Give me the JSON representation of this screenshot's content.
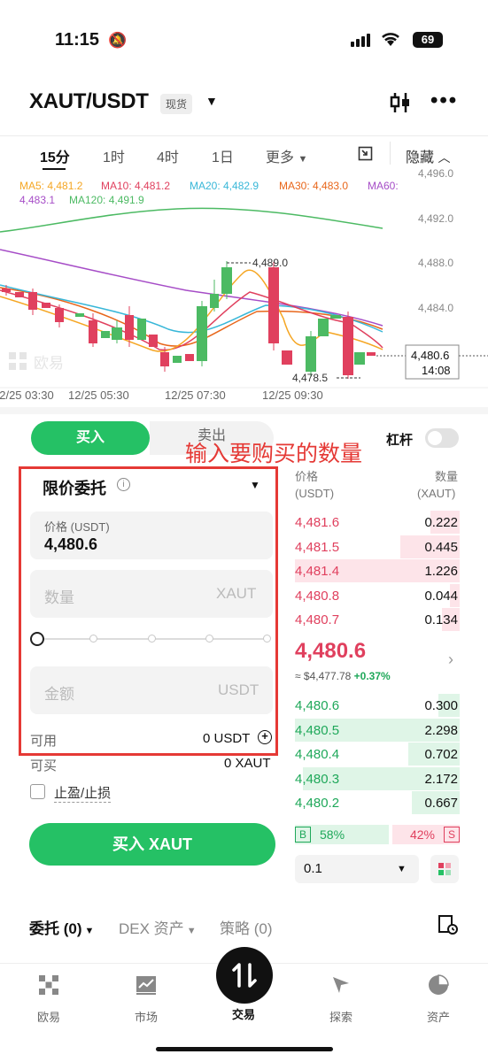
{
  "status": {
    "time": "11:15",
    "battery": "69"
  },
  "header": {
    "pair": "XAUT/USDT",
    "market_badge": "现货"
  },
  "timeframes": [
    "15分",
    "1时",
    "4时",
    "1日",
    "更多"
  ],
  "hide_label": "隐藏",
  "ma_legend": {
    "ma5": "MA5: 4,481.2",
    "ma10": "MA10: 4,481.2",
    "ma20": "MA20: 4,482.9",
    "ma30": "MA30: 4,483.0",
    "ma60_label": "MA60:",
    "ma60_value": "4,483.1",
    "ma120": "MA120: 4,491.9",
    "colors": {
      "ma5": "#f5a623",
      "ma10": "#e0405e",
      "ma20": "#38b7d8",
      "ma30": "#e8661a",
      "ma60": "#a64dc7",
      "ma120": "#4cba63"
    }
  },
  "chart": {
    "y_ticks": [
      "4,496.0",
      "4,492.0",
      "4,488.0",
      "4,484.0"
    ],
    "x_ticks": [
      "12/25 03:30",
      "12/25 05:30",
      "12/25 07:30",
      "12/25 09:30"
    ],
    "high_label": "4,489.0",
    "low_label": "4,478.5",
    "last_price": "4,480.6",
    "countdown": "14:08",
    "watermark": "欧易"
  },
  "trade": {
    "buy_tab": "买入",
    "sell_tab": "卖出",
    "leverage": "杠杆",
    "annotation": "输入要购买的数量",
    "order_type": "限价委托",
    "price_label": "价格 (USDT)",
    "price_value": "4,480.6",
    "qty_placeholder": "数量",
    "qty_unit": "XAUT",
    "amount_placeholder": "金额",
    "amount_unit": "USDT",
    "available_label": "可用",
    "available_value": "0 USDT",
    "can_buy_label": "可买",
    "can_buy_value": "0 XAUT",
    "tpsl_label": "止盈/止损",
    "buy_button": "买入 XAUT"
  },
  "orderbook": {
    "price_header": "价格",
    "price_unit": "(USDT)",
    "qty_header": "数量",
    "qty_unit": "(XAUT)",
    "asks": [
      {
        "price": "4,481.6",
        "qty": "0.222",
        "depth": 0.18
      },
      {
        "price": "4,481.5",
        "qty": "0.445",
        "depth": 0.36
      },
      {
        "price": "4,481.4",
        "qty": "1.226",
        "depth": 1.0
      },
      {
        "price": "4,480.8",
        "qty": "0.044",
        "depth": 0.06
      },
      {
        "price": "4,480.7",
        "qty": "0.134",
        "depth": 0.11
      }
    ],
    "mid_price": "4,480.6",
    "mid_usd": "≈ $4,477.78",
    "mid_change": "+0.37%",
    "bids": [
      {
        "price": "4,480.6",
        "qty": "0.300",
        "depth": 0.13
      },
      {
        "price": "4,480.5",
        "qty": "2.298",
        "depth": 1.0
      },
      {
        "price": "4,480.4",
        "qty": "0.702",
        "depth": 0.31
      },
      {
        "price": "4,480.3",
        "qty": "2.172",
        "depth": 0.95
      },
      {
        "price": "4,480.2",
        "qty": "0.667",
        "depth": 0.29
      }
    ],
    "buy_ratio": "58%",
    "sell_ratio": "42%",
    "buy_ratio_value": 0.58,
    "b_tag": "B",
    "s_tag": "S",
    "depth_value": "0.1"
  },
  "bottom_tabs": {
    "orders": "委托 (0)",
    "dex": "DEX 资产",
    "strategy": "策略 (0)"
  },
  "nav": {
    "home": "欧易",
    "market": "市场",
    "trade": "交易",
    "explore": "探索",
    "assets": "资产"
  }
}
